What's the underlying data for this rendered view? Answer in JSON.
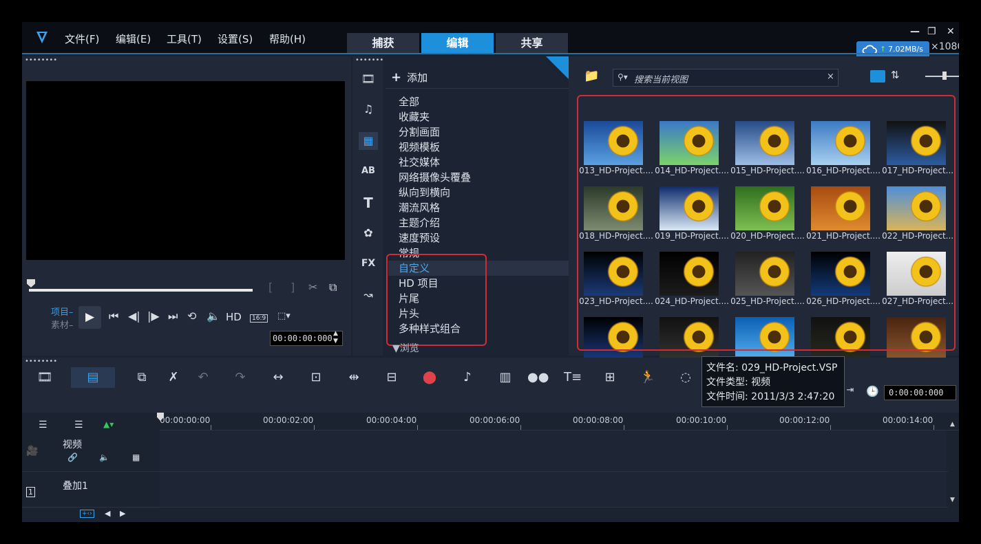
{
  "menu": {
    "file": "文件(F)",
    "edit": "编辑(E)",
    "tools": "工具(T)",
    "settings": "设置(S)",
    "help": "帮助(H)"
  },
  "main_tabs": [
    {
      "label": "捕获",
      "active": false
    },
    {
      "label": "编辑",
      "active": true
    },
    {
      "label": "共享",
      "active": false
    }
  ],
  "window_buttons": {
    "minimize": "—",
    "restore": "❐",
    "close": "✕"
  },
  "network": {
    "speed": "7.02MB/s",
    "arrow": "↑"
  },
  "resolution_suffix": "×1080",
  "player": {
    "project_label": "项目–",
    "clip_label": "素材–",
    "hd_label": "HD",
    "aspect_label": "16:9",
    "timecode": "00:00:00:000"
  },
  "library": {
    "add_label": "添加",
    "search_placeholder": "搜索当前视图",
    "categories": [
      "全部",
      "收藏夹",
      "分割画面",
      "视频模板",
      "社交媒体",
      "网络摄像头覆叠",
      "纵向到横向",
      "潮流风格",
      "主题介绍",
      "速度预设",
      "常规",
      "自定义",
      "HD 项目",
      "片尾",
      "片头",
      "多种样式组合"
    ],
    "selected_category": "自定义",
    "browse_label": "浏览",
    "thumbnails": [
      "013_HD-Project....",
      "014_HD-Project....",
      "015_HD-Project....",
      "016_HD-Project....",
      "017_HD-Project....",
      "018_HD-Project....",
      "019_HD-Project....",
      "020_HD-Project....",
      "021_HD-Project....",
      "022_HD-Project....",
      "023_HD-Project....",
      "024_HD-Project....",
      "025_HD-Project....",
      "026_HD-Project....",
      "027_HD-Project....",
      "",
      "",
      "",
      "",
      ""
    ]
  },
  "tooltip": {
    "filename": "文件名: 029_HD-Project.VSP",
    "filetype": "文件类型: 视频",
    "filetime": "文件时间: 2011/3/3 2:47:20"
  },
  "timeline": {
    "timecode": "0:00:00:000",
    "ruler": [
      "00:00:00:00",
      "00:00:02:00",
      "00:00:04:00",
      "00:00:06:00",
      "00:00:08:00",
      "00:00:10:00",
      "00:00:12:00",
      "00:00:14:00"
    ],
    "tracks": [
      "视频",
      "叠加1"
    ]
  },
  "colors": {
    "accent": "#1e8fdb",
    "highlight_box": "#d32b33",
    "panel": "#212938"
  }
}
